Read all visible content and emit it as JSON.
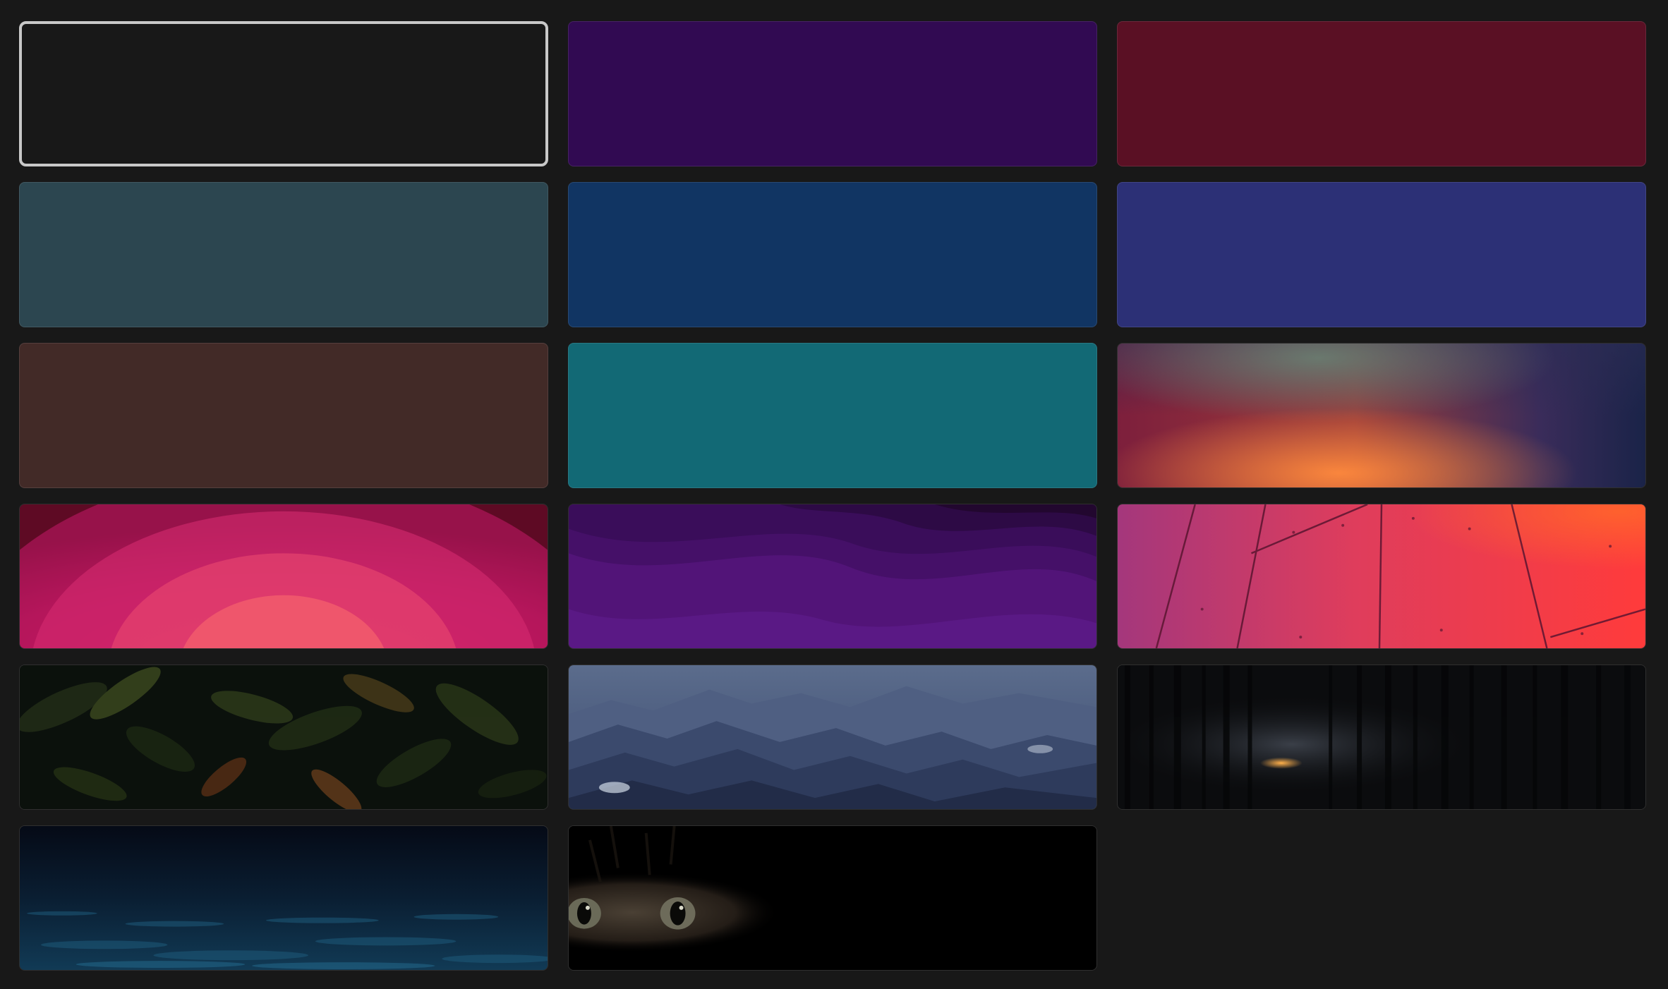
{
  "selected_index": 0,
  "wallpapers": [
    {
      "name": "solid-charcoal",
      "kind": "solid",
      "color": "#181818",
      "selected": true
    },
    {
      "name": "solid-purple",
      "kind": "solid",
      "color": "#310a52"
    },
    {
      "name": "solid-crimson",
      "kind": "solid",
      "color": "#5a1024"
    },
    {
      "name": "solid-slate-teal",
      "kind": "solid",
      "color": "#2c4650"
    },
    {
      "name": "solid-navy",
      "kind": "solid",
      "color": "#113563"
    },
    {
      "name": "solid-indigo",
      "kind": "solid",
      "color": "#2c3076"
    },
    {
      "name": "solid-brown",
      "kind": "solid",
      "color": "#422a27"
    },
    {
      "name": "solid-teal",
      "kind": "solid",
      "color": "#126975"
    },
    {
      "name": "gradient-sunset-glow",
      "kind": "image",
      "colors": [
        "#8a2036",
        "#d46a3a",
        "#1c2950"
      ]
    },
    {
      "name": "gradient-pink-rays",
      "kind": "image",
      "colors": [
        "#6e0d2e",
        "#c7176d",
        "#ff6b6b"
      ]
    },
    {
      "name": "gradient-purple-waves",
      "kind": "image",
      "colors": [
        "#2a0a3e",
        "#5a1585",
        "#4a0f72"
      ]
    },
    {
      "name": "photo-red-panels",
      "kind": "image",
      "colors": [
        "#a2306a",
        "#e8354f",
        "#ff4b35"
      ]
    },
    {
      "name": "photo-jungle-leaves",
      "kind": "image",
      "colors": [
        "#101a12",
        "#2c3d1c",
        "#8a5a2a"
      ]
    },
    {
      "name": "photo-misty-mountains",
      "kind": "image",
      "colors": [
        "#5b6f90",
        "#3b4c70",
        "#1e2a48"
      ]
    },
    {
      "name": "photo-dark-forest",
      "kind": "image",
      "colors": [
        "#0b0c0e",
        "#1a1d22",
        "#d58a3a"
      ]
    },
    {
      "name": "photo-night-ocean",
      "kind": "image",
      "colors": [
        "#050b18",
        "#0d2a40",
        "#1b5470"
      ]
    },
    {
      "name": "photo-cat-eyes",
      "kind": "image",
      "colors": [
        "#000000",
        "#3a3128",
        "#6d6a5e"
      ]
    }
  ]
}
